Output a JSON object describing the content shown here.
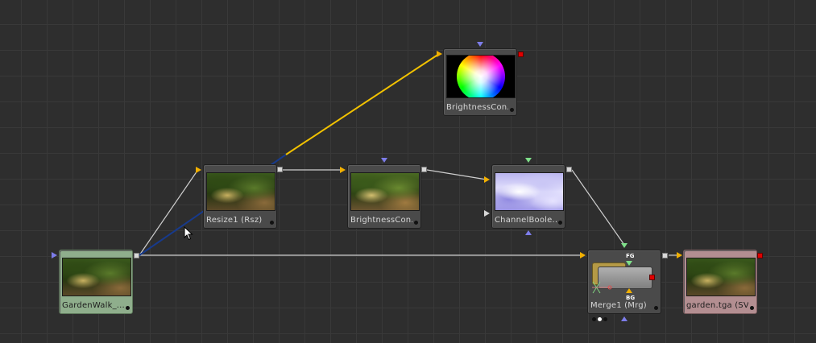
{
  "canvas": {
    "view": "Flow"
  },
  "colors": {
    "background": "#2e2e2e",
    "grid": "#393939",
    "wire_default": "#d0d0d0",
    "wire_highlight": "#f2c200",
    "wire_blue": "#1a3a8a",
    "port_yellow": "#f2b000",
    "port_blue": "#7d7dea",
    "port_green": "#7fe08a",
    "port_red": "#e00000"
  },
  "nodes": {
    "loader": {
      "label": "GardenWalk_...",
      "thumbnail": "garden-photo"
    },
    "resize": {
      "label": "Resize1  (Rsz)",
      "thumbnail": "garden-photo"
    },
    "brightness_mid": {
      "label": "BrightnessCon...",
      "thumbnail": "garden-photo"
    },
    "brightness_top": {
      "label": "BrightnessCon...",
      "thumbnail": "color-wheel"
    },
    "channel_boolean": {
      "label": "ChannelBoole...",
      "thumbnail": "inverted-garden"
    },
    "merge": {
      "label": "Merge1  (Mrg)",
      "fg_tag": "FG",
      "bg_tag": "BG"
    },
    "saver": {
      "label": "garden.tga  (SV)",
      "thumbnail": "garden-photo"
    }
  }
}
